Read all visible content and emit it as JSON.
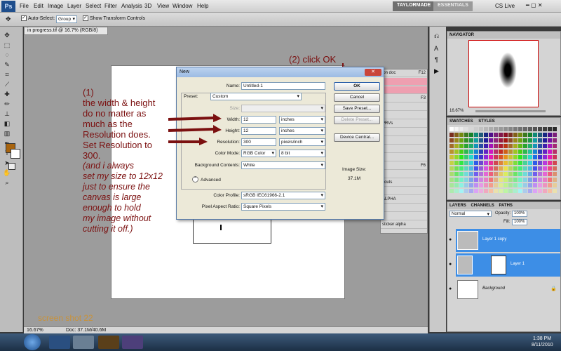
{
  "app": {
    "logo": "Ps",
    "menus": [
      "File",
      "Edit",
      "Image",
      "Layer",
      "Select",
      "Filter",
      "Analysis",
      "3D",
      "View",
      "Window",
      "Help"
    ],
    "workspace_buttons": [
      "TAYLORMADE",
      "ESSENTIALS"
    ],
    "cs_live": "CS Live"
  },
  "options_bar": {
    "auto_select_label": "Auto-Select:",
    "auto_select_value": "Group",
    "show_transform_label": "Show Transform Controls"
  },
  "document": {
    "tab_title": "in progress.tif @ 16.7% (RGB/8)",
    "zoom": "16.67%",
    "doc_info": "Doc: 37.1M/40.6M"
  },
  "dialog": {
    "title": "New",
    "name_label": "Name:",
    "name_value": "Untitled-1",
    "preset_label": "Preset:",
    "preset_value": "Custom",
    "size_label": "Size:",
    "width_label": "Width:",
    "width_value": "12",
    "width_unit": "inches",
    "height_label": "Height:",
    "height_value": "12",
    "height_unit": "inches",
    "resolution_label": "Resolution:",
    "resolution_value": "300",
    "resolution_unit": "pixels/inch",
    "color_mode_label": "Color Mode:",
    "color_mode_value": "RGB Color",
    "bit_depth": "8 bit",
    "bg_contents_label": "Background Contents:",
    "bg_contents_value": "White",
    "advanced_label": "Advanced",
    "color_profile_label": "Color Profile:",
    "color_profile_value": "sRGB IEC61966-2.1",
    "pixel_aspect_label": "Pixel Aspect Ratio:",
    "pixel_aspect_value": "Square Pixels",
    "ok_label": "OK",
    "cancel_label": "Cancel",
    "save_preset_label": "Save Preset...",
    "delete_preset_label": "Delete Preset...",
    "device_central_label": "Device Central...",
    "image_size_label": "Image Size:",
    "image_size_value": "37.1M"
  },
  "mid_panel": {
    "rows": [
      "ion doc",
      "",
      "",
      "",
      "",
      "",
      "PRVs",
      "",
      "",
      "",
      "",
      "",
      "",
      "youts",
      "",
      "ALPHA",
      "",
      "",
      "sticker alpha"
    ],
    "shortcuts": [
      "F12",
      "F3",
      "F6"
    ]
  },
  "panels": {
    "navigator_tab": "NAVIGATOR",
    "navigator_zoom": "16.67%",
    "swatches_tab": "SWATCHES",
    "styles_tab": "STYLES",
    "layers_tab": "LAYERS",
    "channels_tab": "CHANNELS",
    "paths_tab": "PATHS",
    "blend_mode": "Normal",
    "opacity_label": "Opacity:",
    "opacity_value": "100%",
    "fill_label": "Fill:",
    "fill_value": "100%",
    "layers": [
      "Layer 1 copy",
      "Layer 1",
      "Background"
    ]
  },
  "annotations": {
    "click_ok": "(2) click OK",
    "step1_lines": [
      "(1)",
      "the width & height",
      "do no matter as",
      "much as the",
      "Resolution does.",
      "Set Resolution to",
      "300."
    ],
    "step1_italic": [
      "(and i always",
      "set my size to 12x12",
      "just to ensure the",
      "canvas is large",
      "enough to hold",
      "my image without",
      "cutting it off.)"
    ],
    "screenshot_label": "screen shot 22"
  },
  "taskbar": {
    "time": "1:38 PM",
    "date": "8/11/2010"
  },
  "colors": {
    "annotation": "#7b1010",
    "layer_selected": "#3d8ee6",
    "label_orange": "#c8923a"
  }
}
